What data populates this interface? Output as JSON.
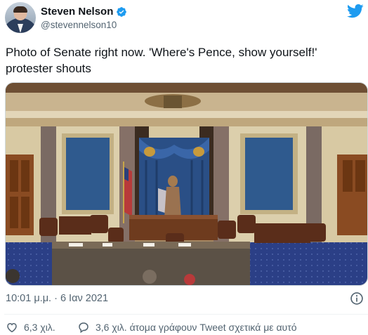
{
  "author": {
    "name": "Steven Nelson",
    "handle": "@stevennelson10",
    "verified": true
  },
  "tweet": {
    "text": "Photo of Senate right now. 'Where's Pence, show yourself!' protester shouts"
  },
  "meta": {
    "timestamp": "10:01 μ.μ. · 6 Ιαν 2021"
  },
  "actions": {
    "likes": "6,3 χιλ.",
    "replies": "3,6 χιλ. άτομα γράφουν Tweet σχετικά με αυτό"
  },
  "colors": {
    "brand_blue": "#1d9bf0",
    "secondary_text": "#536471"
  },
  "icons": {
    "verified": "verified-badge-icon",
    "brand": "twitter-bird-icon",
    "info": "info-icon",
    "like": "heart-icon",
    "reply": "speech-bubble-icon"
  }
}
